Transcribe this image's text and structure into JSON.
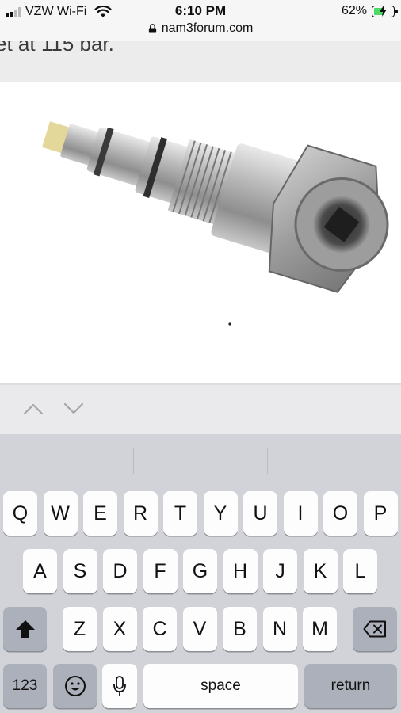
{
  "status_bar": {
    "carrier": "VZW Wi-Fi",
    "time": "6:10 PM",
    "url": "nam3forum.com",
    "battery": "62%",
    "battery_level": 0.62
  },
  "page": {
    "cut_text": "et at 115 bar."
  },
  "keyboard": {
    "row1": [
      "Q",
      "W",
      "E",
      "R",
      "T",
      "Y",
      "U",
      "I",
      "O",
      "P"
    ],
    "row2": [
      "A",
      "S",
      "D",
      "F",
      "G",
      "H",
      "J",
      "K",
      "L"
    ],
    "row3": [
      "Z",
      "X",
      "C",
      "V",
      "B",
      "N",
      "M"
    ],
    "numbers_label": "123",
    "space_label": "space",
    "return_label": "return"
  },
  "colors": {
    "battery_fill": "#4cd964",
    "keyboard_bg": "#d1d3d9",
    "dark_key": "#abb0ba"
  }
}
